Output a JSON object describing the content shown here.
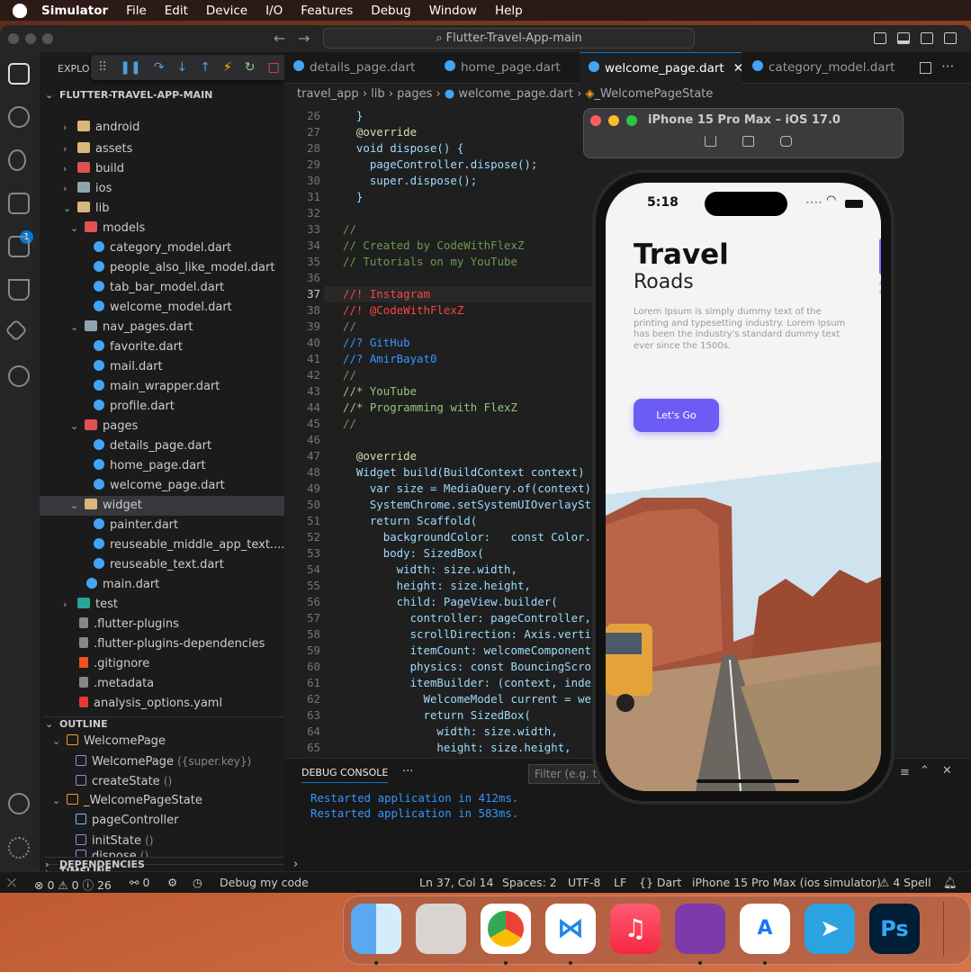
{
  "menubar": {
    "items": [
      "Simulator",
      "File",
      "Edit",
      "Device",
      "I/O",
      "Features",
      "Debug",
      "Window",
      "Help"
    ]
  },
  "window": {
    "command_center": "Flutter-Travel-App-main"
  },
  "explorer": {
    "header": "EXPLO",
    "root": "FLUTTER-TRAVEL-APP-MAIN",
    "items": [
      "android",
      "assets",
      "build",
      "ios",
      "lib",
      "models",
      "category_model.dart",
      "people_also_like_model.dart",
      "tab_bar_model.dart",
      "welcome_model.dart",
      "nav_pages.dart",
      "favorite.dart",
      "mail.dart",
      "main_wrapper.dart",
      "profile.dart",
      "pages",
      "details_page.dart",
      "home_page.dart",
      "welcome_page.dart",
      "widget",
      "painter.dart",
      "reuseable_middle_app_text....",
      "reuseable_text.dart",
      "main.dart",
      "test",
      ".flutter-plugins",
      ".flutter-plugins-dependencies",
      ".gitignore",
      ".metadata",
      "analysis_options.yaml"
    ]
  },
  "outline": {
    "header": "OUTLINE",
    "items": [
      "WelcomePage",
      "WelcomePage",
      "({super.key})",
      "createState",
      "()",
      "_WelcomePageState",
      "pageController",
      "initState",
      "()",
      "dispose",
      "()"
    ]
  },
  "timeline": "TIMELINE",
  "dependencies": "DEPENDENCIES",
  "activity": {
    "debug_badge": "1"
  },
  "tabs": [
    "details_page.dart",
    "home_page.dart",
    "welcome_page.dart",
    "category_model.dart"
  ],
  "breadcrumb": [
    "travel_app",
    "lib",
    "pages",
    "welcome_page.dart",
    "_WelcomePageState"
  ],
  "code": {
    "line_numbers": [
      "26",
      "27",
      "28",
      "29",
      "30",
      "31",
      "32",
      "33",
      "34",
      "35",
      "36",
      "37",
      "38",
      "39",
      "40",
      "41",
      "42",
      "43",
      "44",
      "45",
      "46",
      "47",
      "48",
      "49",
      "50",
      "51",
      "52",
      "53",
      "54",
      "55",
      "56",
      "57",
      "58",
      "59",
      "60",
      "61",
      "62",
      "63",
      "64",
      "65"
    ],
    "lines": [
      "  }",
      "  @override",
      "  void dispose() {",
      "    pageController.dispose();",
      "    super.dispose();",
      "  }",
      "",
      "//",
      "// Created by CodeWithFlexZ",
      "// Tutorials on my YouTube",
      "",
      "//! Instagram",
      "//! @CodeWithFlexZ",
      "//",
      "//? GitHub",
      "//? AmirBayat0",
      "//",
      "//* YouTube",
      "//* Programming with FlexZ",
      "//",
      "",
      "  @override",
      "  Widget build(BuildContext context) {",
      "    var size = MediaQuery.of(context).",
      "    SystemChrome.setSystemUIOverlaySty",
      "    return Scaffold(",
      "      backgroundColor:   const Color.f",
      "      body: SizedBox(",
      "        width: size.width,",
      "        height: size.height,",
      "        child: PageView.builder(",
      "          controller: pageController,",
      "          scrollDirection: Axis.vertic",
      "          itemCount: welcomeComponents",
      "          physics: const BouncingScrol",
      "          itemBuilder: (context, index",
      "            WelcomeModel current = wel",
      "            return SizedBox(",
      "              width: size.width,",
      "              height: size.height,"
    ]
  },
  "panel": {
    "title": "DEBUG CONSOLE",
    "more": "···",
    "filter_placeholder": "Filter (e.g. t",
    "logs": [
      "Restarted application in 412ms.",
      "Restarted application in 583ms."
    ]
  },
  "status": {
    "errors": "0",
    "warnings": "0",
    "info": "26",
    "ports": "0",
    "debug": "Debug my code",
    "position": "Ln 37, Col 14",
    "spaces": "Spaces: 2",
    "encoding": "UTF-8",
    "eol": "LF",
    "language": "Dart",
    "device": "iPhone 15 Pro Max (ios simulator)",
    "spell": "4 Spell"
  },
  "simulator": {
    "title": "iPhone 15 Pro Max – iOS 17.0",
    "time": "5:18",
    "app": {
      "title": "Travel",
      "subtitle": "Roads",
      "body": "Lorem Ipsum is simply dummy text of the printing and typesetting industry. Lorem Ipsum has been the industry's standard dummy text ever since the 1500s.",
      "button": "Let's Go",
      "accent": "#6c5cf5"
    }
  },
  "dock": {
    "apps": [
      "finder-icon",
      "launchpad-icon",
      "chrome-icon",
      "vscode-icon",
      "music-icon",
      "github-desktop-icon",
      "xcode-icon",
      "telegram-icon",
      "photoshop-icon"
    ],
    "ps_label": "Ps"
  }
}
